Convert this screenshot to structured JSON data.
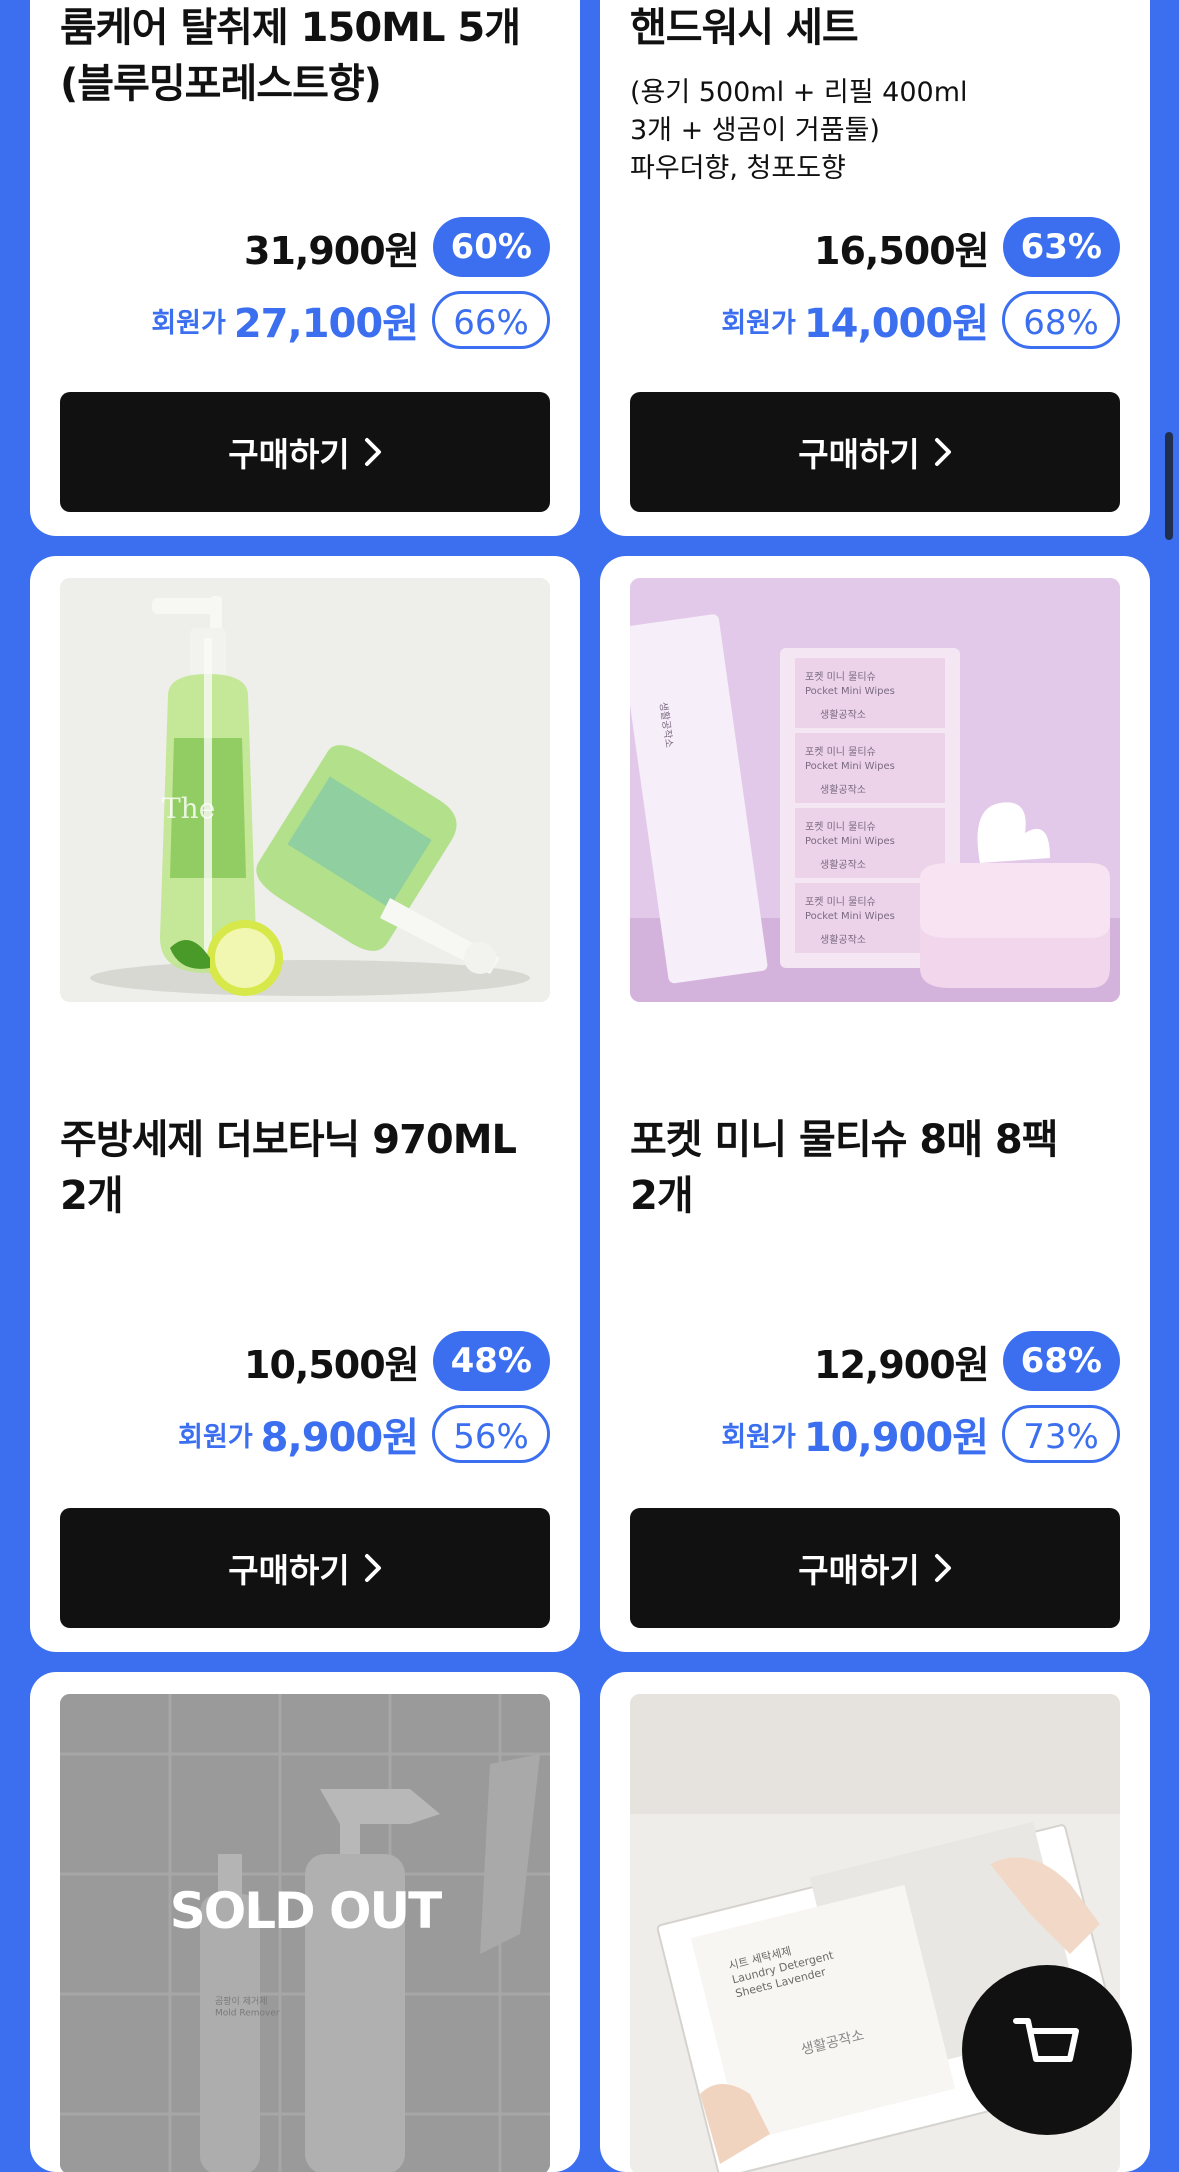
{
  "products": [
    {
      "title": "룸케어 탈취제 150ML 5개\n(블루밍포레스트향)",
      "subtitle": "",
      "price": "31,900원",
      "discount": "60%",
      "member_label": "회원가",
      "member_price": "27,100원",
      "member_discount": "66%",
      "buy_label": "구매하기"
    },
    {
      "title": "핸드워시 세트",
      "subtitle": "(용기 500ml + 리필 400ml\n3개 + 생곰이 거품툴)\n파우더향, 청포도향",
      "price": "16,500원",
      "discount": "63%",
      "member_label": "회원가",
      "member_price": "14,000원",
      "member_discount": "68%",
      "buy_label": "구매하기"
    },
    {
      "title": "주방세제 더보타닉 970ML\n2개",
      "subtitle": "",
      "price": "10,500원",
      "discount": "48%",
      "member_label": "회원가",
      "member_price": "8,900원",
      "member_discount": "56%",
      "buy_label": "구매하기",
      "image": "dish-soap-bottles-with-lime"
    },
    {
      "title": "포켓 미니 물티슈 8매 8팩\n2개",
      "subtitle": "",
      "price": "12,900원",
      "discount": "68%",
      "member_label": "회원가",
      "member_price": "10,900원",
      "member_discount": "73%",
      "buy_label": "구매하기",
      "image": "pocket-mini-wipes-packs"
    },
    {
      "image": "mold-remover-spray-bottles",
      "sold_out_label": "SOLD OUT"
    },
    {
      "image": "laundry-detergent-sheets-box"
    }
  ],
  "image_texts": {
    "bottle_text": "The",
    "wipes_text": "포켓 미니 물티슈\nPocket Mini Wipes",
    "wipes_brand": "생활공작소",
    "mold_text": "곰팡이 제거제\nMold Remover",
    "laundry_text": "시트 세탁세제\nLaundry Detergent\nSheets Lavender",
    "laundry_brand": "생활공작소"
  },
  "cart_button": "cart-icon",
  "colors": {
    "accent": "#3b6ff0",
    "button": "#111111"
  }
}
